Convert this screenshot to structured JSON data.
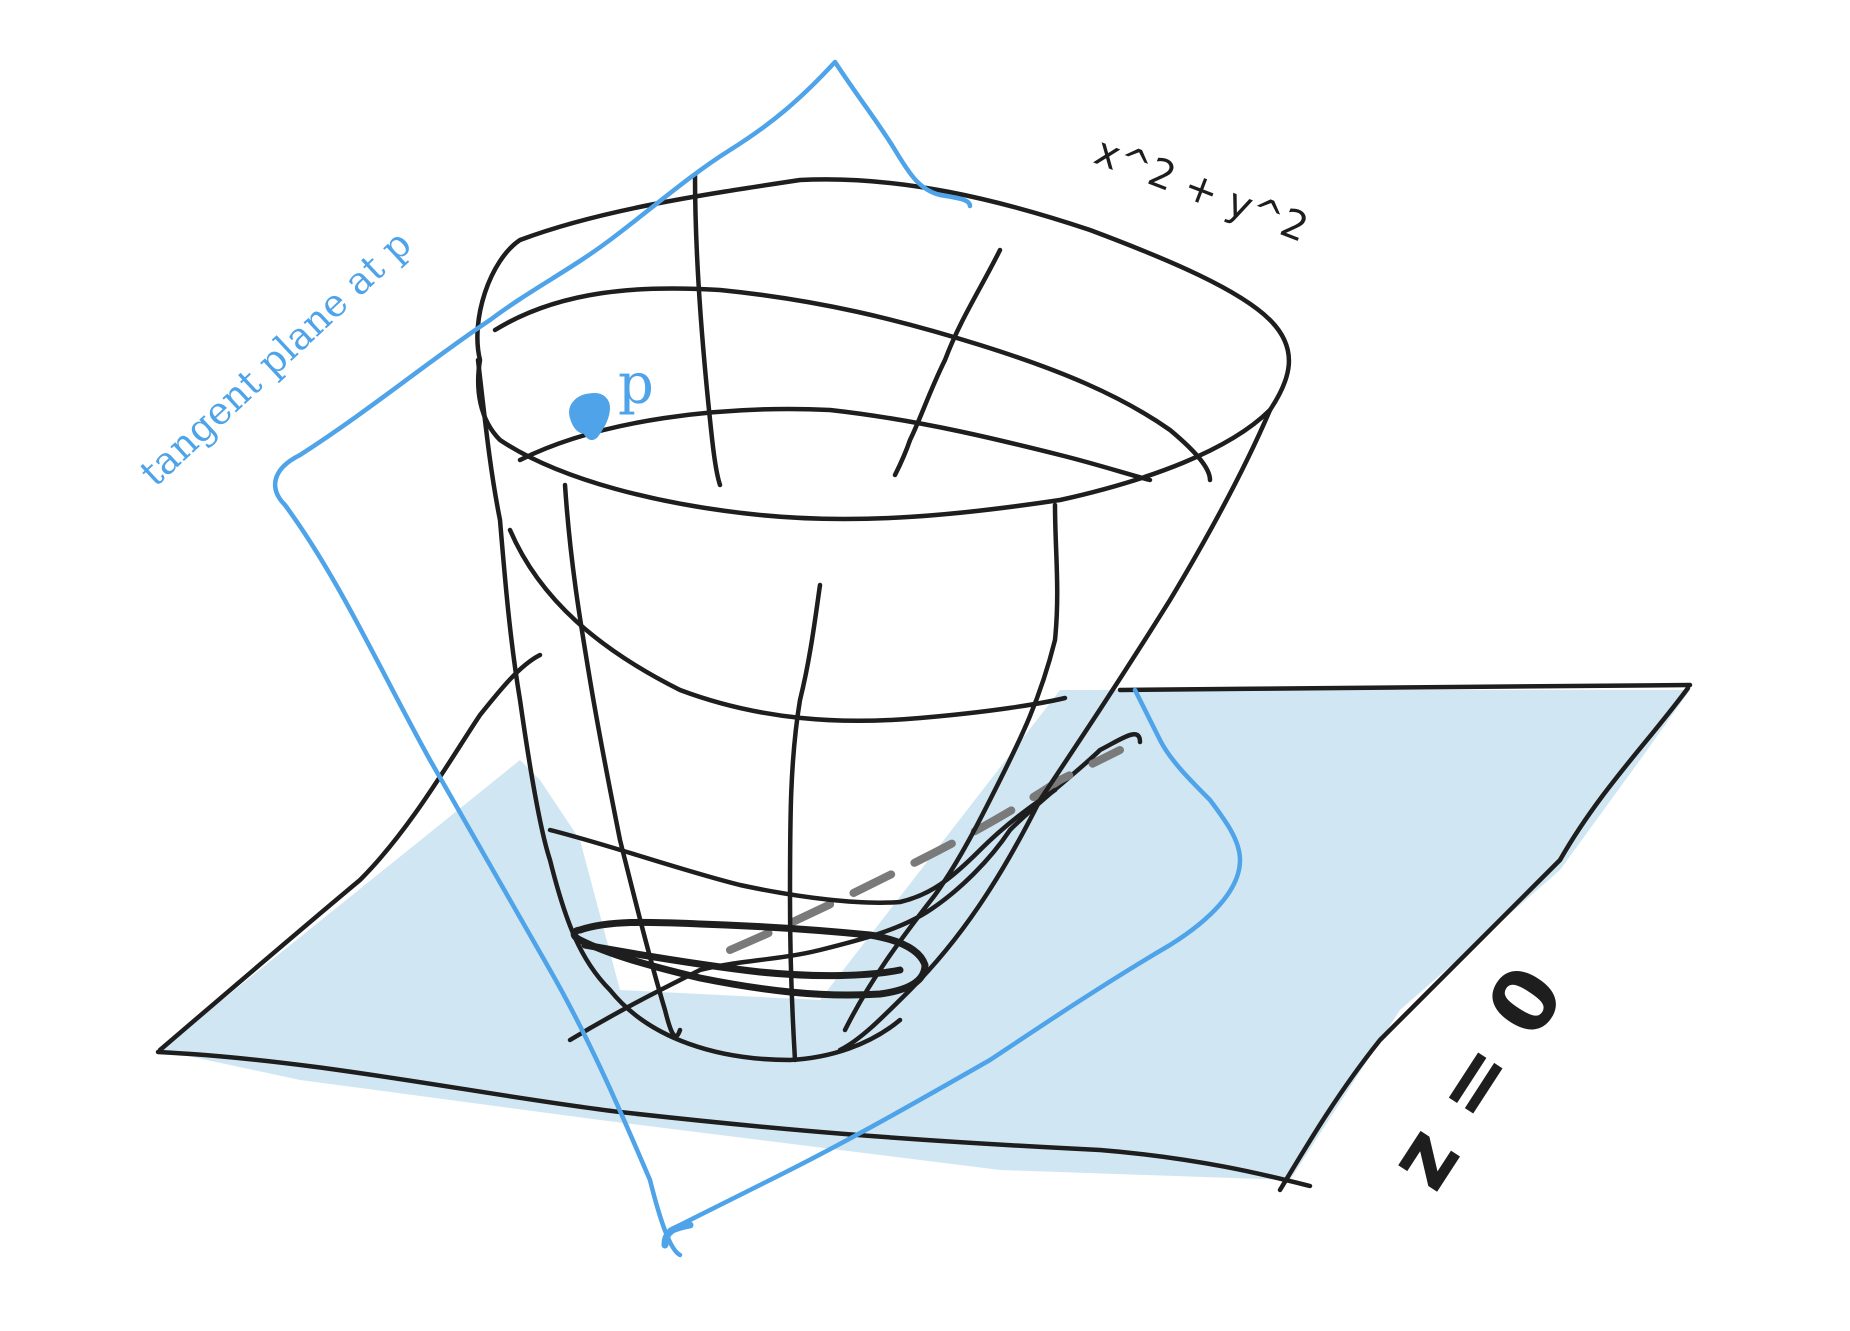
{
  "labels": {
    "tangent_plane": "tangent plane at p",
    "point": "p",
    "surface_equation": "x^2 + y^2",
    "ground_plane": "z = 0"
  },
  "colors": {
    "ink": "#1e1e1e",
    "blue": "#4fa3e8",
    "plane_fill": "#a9d4ea"
  }
}
